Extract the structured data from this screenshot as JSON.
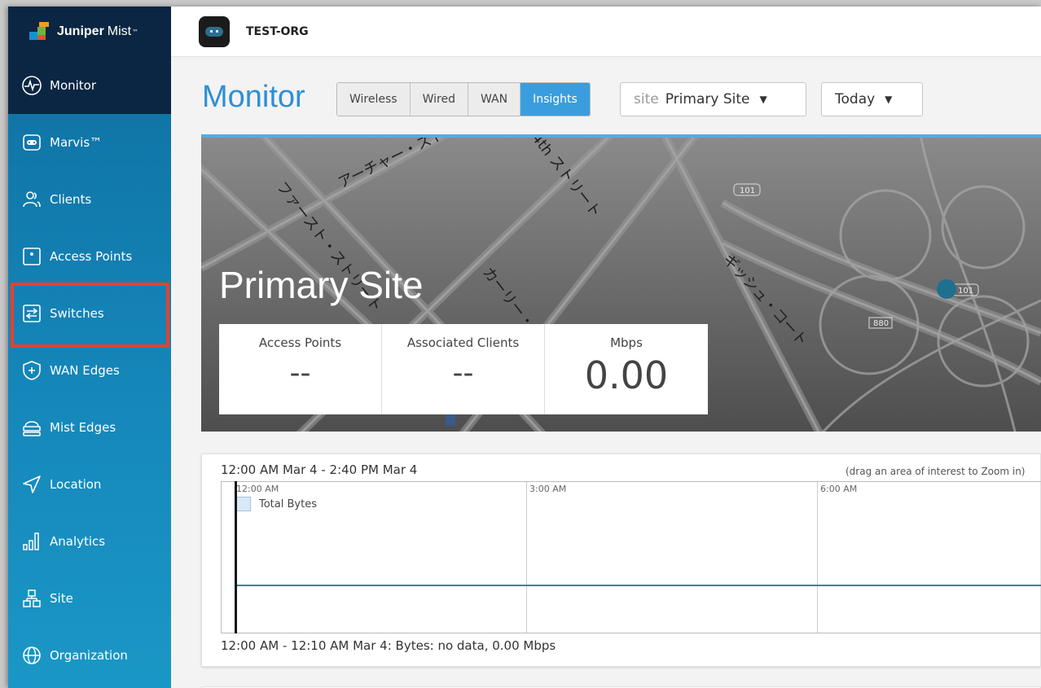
{
  "brand": {
    "name": "Juniper",
    "name2": "Mist",
    "tm": "™"
  },
  "org": {
    "name": "TEST-ORG"
  },
  "sidebar": {
    "items": [
      {
        "label": "Monitor",
        "icon": "monitor-icon",
        "active": true
      },
      {
        "label": "Marvis™",
        "icon": "marvis-icon"
      },
      {
        "label": "Clients",
        "icon": "clients-icon"
      },
      {
        "label": "Access Points",
        "icon": "access-points-icon"
      },
      {
        "label": "Switches",
        "icon": "switches-icon",
        "highlighted": true
      },
      {
        "label": "WAN Edges",
        "icon": "wan-edges-icon"
      },
      {
        "label": "Mist Edges",
        "icon": "mist-edges-icon"
      },
      {
        "label": "Location",
        "icon": "location-icon"
      },
      {
        "label": "Analytics",
        "icon": "analytics-icon"
      },
      {
        "label": "Site",
        "icon": "site-icon"
      },
      {
        "label": "Organization",
        "icon": "organization-icon"
      }
    ]
  },
  "main": {
    "title": "Monitor",
    "tabs": [
      {
        "label": "Wireless"
      },
      {
        "label": "Wired"
      },
      {
        "label": "WAN"
      },
      {
        "label": "Insights",
        "selected": true
      }
    ],
    "site_dropdown": {
      "prefix": "site",
      "value": "Primary Site"
    },
    "time_dropdown": {
      "value": "Today"
    }
  },
  "banner": {
    "site_name": "Primary Site",
    "stats": [
      {
        "label": "Access Points",
        "value": "--"
      },
      {
        "label": "Associated Clients",
        "value": "--"
      },
      {
        "label": "Mbps",
        "value": "0.00"
      }
    ],
    "map_labels": [
      "ファースト・ストリート",
      "アーチャー・ストリート",
      "4th ストリート",
      "カーリー・ストリート",
      "ギッシュ・コート",
      "101",
      "101",
      "880"
    ]
  },
  "timeline": {
    "range": "12:00 AM Mar 4 - 2:40 PM Mar 4",
    "hint": "(drag an area of interest to Zoom in)",
    "ticks": [
      "12:00 AM",
      "3:00 AM",
      "6:00 AM"
    ],
    "legend": "Total Bytes",
    "status": "12:00 AM - 12:10 AM Mar 4: Bytes: no data, 0.00 Mbps"
  },
  "colors": {
    "sidebar_top": "#0e6fa0",
    "sidebar_dark": "#0a2642",
    "accent": "#3a9ede",
    "title": "#2f8fd3",
    "highlight_box": "#e8402f",
    "series_line": "#2b8e8e",
    "map_marker": "#1f6f8f"
  }
}
